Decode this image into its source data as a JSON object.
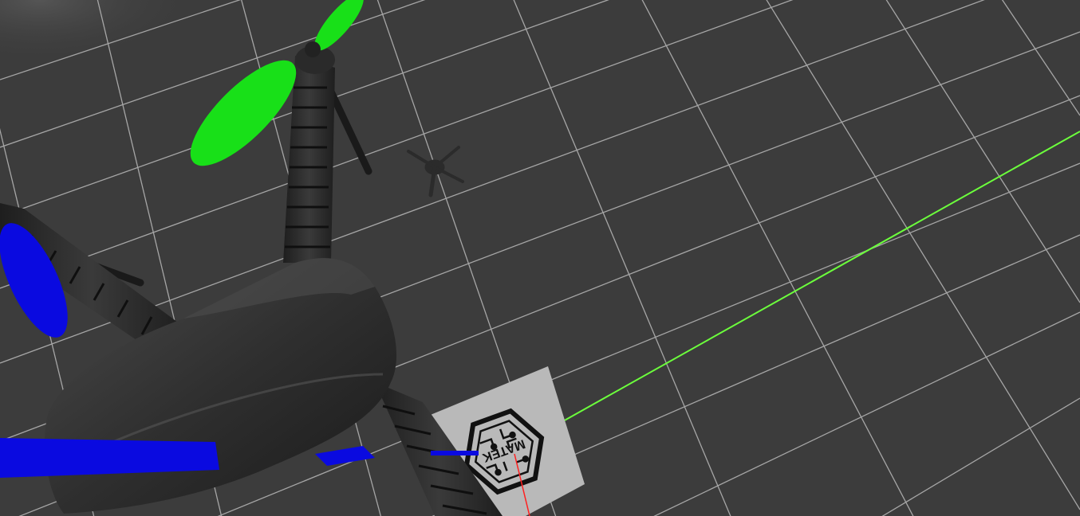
{
  "viewport": {
    "type": "3d-simulation-view",
    "background_color": "#3c3c3c",
    "grid_color": "#a6a6a6"
  },
  "objects": [
    {
      "name": "quadcopter-drone",
      "body_color": "#2f2f2f"
    },
    {
      "name": "propeller-green",
      "color": "#18e018"
    },
    {
      "name": "propeller-blue",
      "color": "#0a0ae0"
    },
    {
      "name": "drone-shadow",
      "color": "#2c2c2c"
    },
    {
      "name": "aruco-marker-board",
      "color": "#b9b9b9"
    }
  ],
  "axes": {
    "y_axis_color": "#6cff3c",
    "x_axis_color": "#ff2020"
  },
  "marker": {
    "text": "MATEK"
  }
}
